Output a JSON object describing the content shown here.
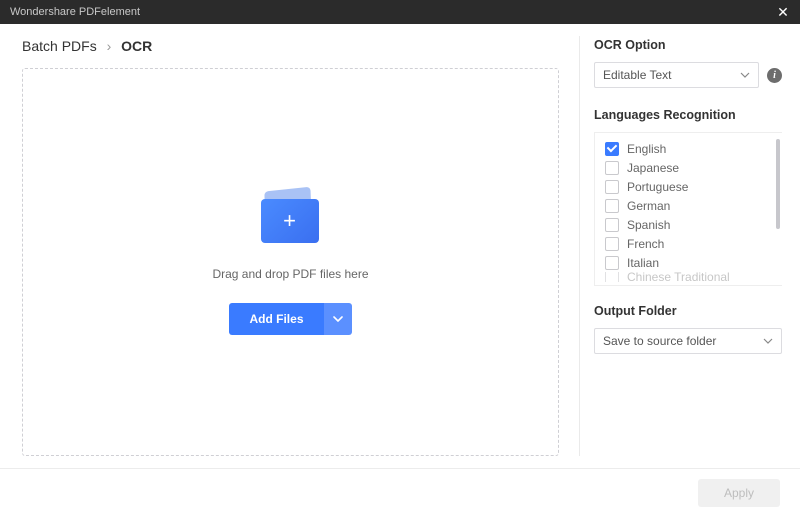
{
  "window": {
    "title": "Wondershare PDFelement"
  },
  "breadcrumb": {
    "parent": "Batch PDFs",
    "current": "OCR"
  },
  "dropzone": {
    "hint": "Drag and drop PDF files here",
    "add_label": "Add Files"
  },
  "ocr_option": {
    "title": "OCR Option",
    "selected": "Editable Text"
  },
  "languages": {
    "title": "Languages Recognition",
    "items": [
      {
        "label": "English",
        "checked": true
      },
      {
        "label": "Japanese",
        "checked": false
      },
      {
        "label": "Portuguese",
        "checked": false
      },
      {
        "label": "German",
        "checked": false
      },
      {
        "label": "Spanish",
        "checked": false
      },
      {
        "label": "French",
        "checked": false
      },
      {
        "label": "Italian",
        "checked": false
      }
    ],
    "partial": {
      "label": "Chinese Traditional",
      "checked": false
    }
  },
  "output": {
    "title": "Output Folder",
    "selected": "Save to source folder"
  },
  "footer": {
    "apply_label": "Apply"
  }
}
